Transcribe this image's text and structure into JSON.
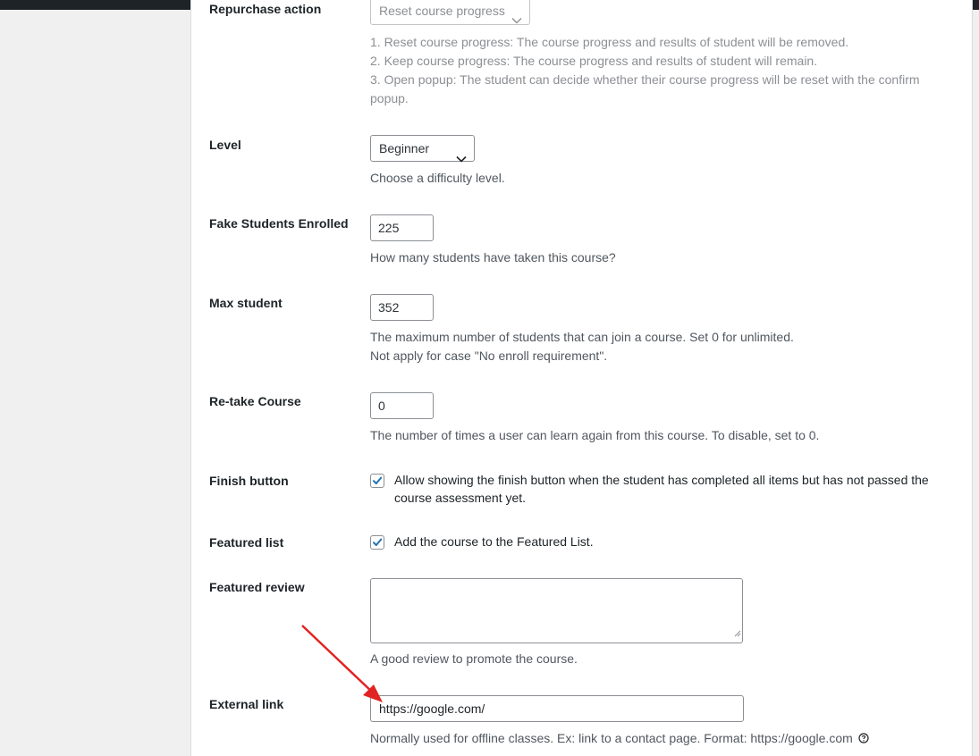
{
  "accent": "#2271b1",
  "annotation_color": "#e02424",
  "repurchase": {
    "label": "Repurchase action",
    "select_value": "Reset course progress",
    "desc_1": "1. Reset course progress: The course progress and results of student will be removed.",
    "desc_2": "2. Keep course progress: The course progress and results of student will remain.",
    "desc_3a": "3. Open popup: The student can decide whether their course progress will be reset with the confirm",
    "desc_3b": "popup."
  },
  "level": {
    "label": "Level",
    "select_value": "Beginner",
    "desc": "Choose a difficulty level."
  },
  "fake_students": {
    "label": "Fake Students Enrolled",
    "value": "225",
    "desc": "How many students have taken this course?"
  },
  "max_student": {
    "label": "Max student",
    "value": "352",
    "desc_1": "The maximum number of students that can join a course. Set 0 for unlimited.",
    "desc_2": "Not apply for case \"No enroll requirement\"."
  },
  "retake": {
    "label": "Re-take Course",
    "value": "0",
    "desc": "The number of times a user can learn again from this course. To disable, set to 0."
  },
  "finish_button": {
    "label": "Finish button",
    "checked": true,
    "text_1": "Allow showing the finish button when the student has completed all items but has not passed the",
    "text_2": "course assessment yet."
  },
  "featured_list": {
    "label": "Featured list",
    "checked": true,
    "text": "Add the course to the Featured List."
  },
  "featured_review": {
    "label": "Featured review",
    "value": "",
    "desc": "A good review to promote the course."
  },
  "external_link": {
    "label": "External link",
    "value": "https://google.com/",
    "desc": "Normally used for offline classes. Ex: link to a contact page. Format: https://google.com"
  }
}
